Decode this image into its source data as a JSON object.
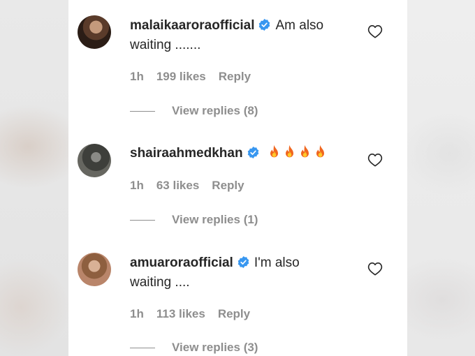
{
  "comments": [
    {
      "username": "malaikaaroraofficial",
      "text_line1": "Am also",
      "text_line2": "waiting .......",
      "time": "1h",
      "likes": "199 likes",
      "reply_label": "Reply",
      "view_replies": "View replies (8)"
    },
    {
      "username": "shairaahmedkhan",
      "text_line1": "🔥🔥🔥🔥",
      "time": "1h",
      "likes": "63 likes",
      "reply_label": "Reply",
      "view_replies": "View replies (1)"
    },
    {
      "username": "amuaroraofficial",
      "text_line1": "I'm also",
      "text_line2": "waiting ....",
      "time": "1h",
      "likes": "113 likes",
      "reply_label": "Reply",
      "view_replies": "View replies (3)"
    }
  ],
  "icons": {
    "verified": "verified-badge-icon",
    "heart": "heart-outline-icon",
    "fire": "fire-emoji-icon"
  },
  "colors": {
    "verified_blue": "#3897f0",
    "text": "#262626",
    "muted": "#8e8e8e"
  }
}
